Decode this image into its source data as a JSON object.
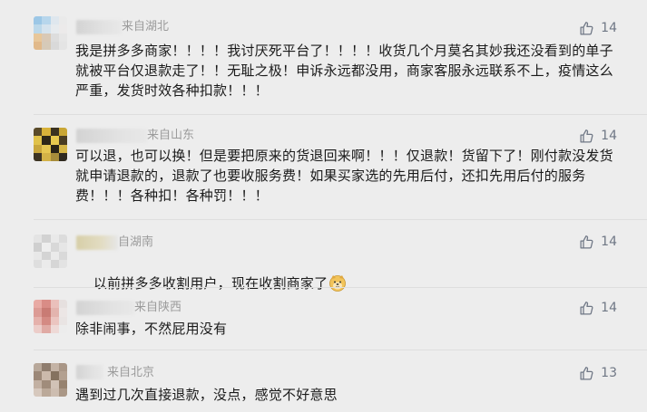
{
  "comments": [
    {
      "location": "来自湖北",
      "likes": "14",
      "text": "我是拼多多商家！！！！我讨厌死平台了！！！！收货几个月莫名其妙我还没看到的单子就被平台仅退款走了！！无耻之极！申诉永远都没用，商家客服永远联系不上，疫情这么严重，发货时效各种扣款！！！"
    },
    {
      "location": "来自山东",
      "likes": "14",
      "text": "可以退，也可以换！但是要把原来的货退回来啊！！！仅退款！货留下了！刚付款没发货就申请退款的，退款了也要收服务费！如果买家选的先用后付，还扣先用后付的服务费！！！各种扣！各种罚！！！"
    },
    {
      "location": "自湖南",
      "likes": "14",
      "text": "以前拼多多收割用户，现在收割商家了",
      "emoji": "doge-emoji"
    },
    {
      "location": "来自陕西",
      "likes": "14",
      "text": "除非闹事，不然屁用没有"
    },
    {
      "location": "来自北京",
      "likes": "13",
      "text": "遇到过几次直接退款，没点，感觉不好意思"
    }
  ],
  "icons": {
    "like": "thumbs-up-icon"
  },
  "colors": {
    "background": "#ededed",
    "text": "#1a1a1a",
    "meta": "#9b9b9b",
    "like": "#6f7785"
  }
}
